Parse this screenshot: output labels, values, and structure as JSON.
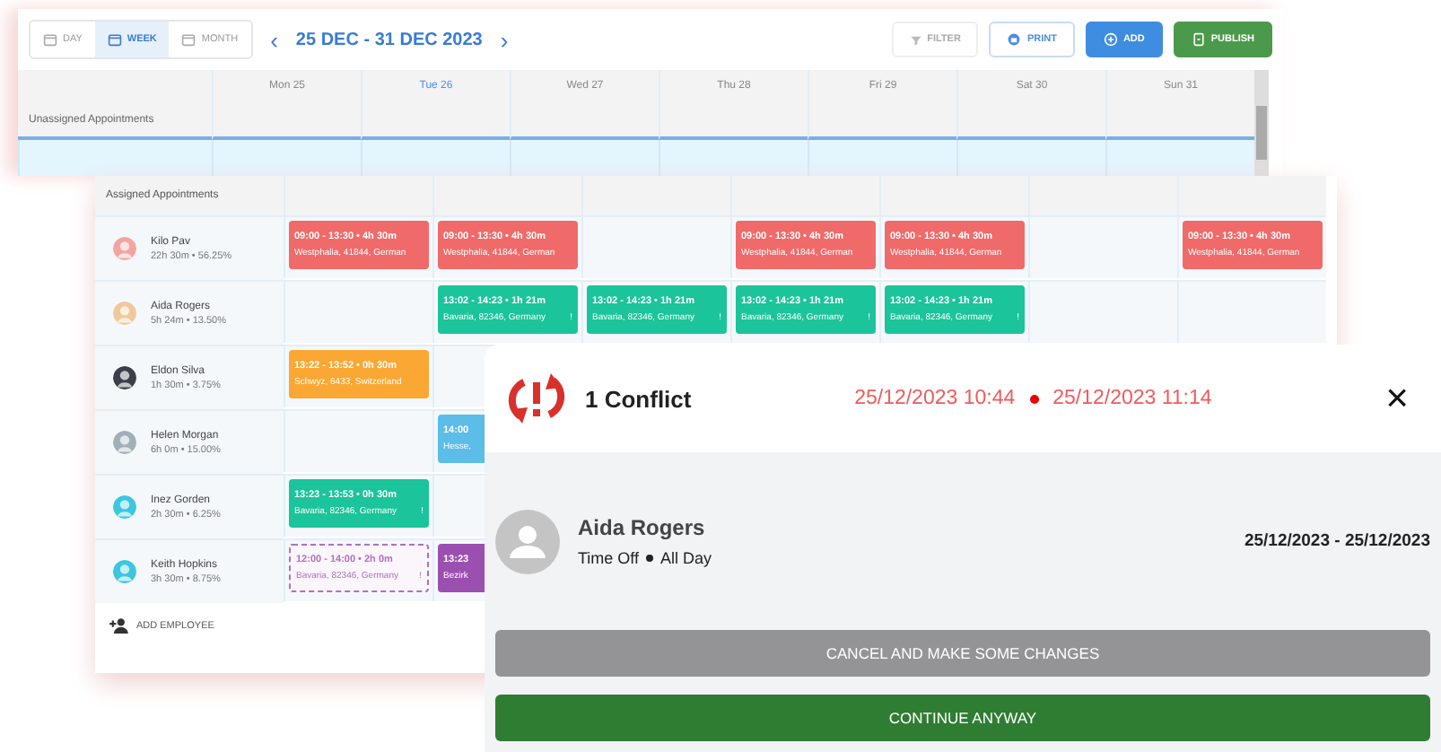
{
  "toolbar": {
    "views": [
      {
        "label": "DAY",
        "selected": false
      },
      {
        "label": "WEEK",
        "selected": true
      },
      {
        "label": "MONTH",
        "selected": false
      }
    ],
    "prev": "‹",
    "range": "25 DEC - 31 DEC 2023",
    "next": "›",
    "actions": [
      {
        "label": "FILTER",
        "kind": "plain"
      },
      {
        "label": "PRINT",
        "kind": "outline"
      },
      {
        "label": "ADD",
        "kind": "primary"
      },
      {
        "label": "PUBLISH",
        "kind": "success"
      }
    ]
  },
  "days": [
    {
      "label": "Mon 25",
      "today": false
    },
    {
      "label": "Tue 26",
      "today": true
    },
    {
      "label": "Wed 27",
      "today": false
    },
    {
      "label": "Thu 28",
      "today": false
    },
    {
      "label": "Fri 29",
      "today": false
    },
    {
      "label": "Sat 30",
      "today": false
    },
    {
      "label": "Sun 31",
      "today": false
    }
  ],
  "unassigned": {
    "label": "Unassigned Appointments"
  },
  "assigned": {
    "label": "Assigned Appointments"
  },
  "employees": [
    {
      "name": "Kilo Pav",
      "stats": "22h 30m • 56.25%",
      "color": "#f4a4a0",
      "cells": [
        {
          "kind": "solid",
          "color": "#f06a6a",
          "time": "09:00 - 13:30 • 4h 30m",
          "place": "Westphalia, 41844, German"
        },
        {
          "kind": "solid",
          "color": "#f06a6a",
          "time": "09:00 - 13:30 • 4h 30m",
          "place": "Westphalia, 41844, German"
        },
        {
          "kind": "empty"
        },
        {
          "kind": "solid",
          "color": "#f06a6a",
          "time": "09:00 - 13:30 • 4h 30m",
          "place": "Westphalia, 41844, German"
        },
        {
          "kind": "solid",
          "color": "#f06a6a",
          "time": "09:00 - 13:30 • 4h 30m",
          "place": "Westphalia, 41844, German"
        },
        {
          "kind": "empty"
        },
        {
          "kind": "solid",
          "color": "#f06a6a",
          "time": "09:00 - 13:30 • 4h 30m",
          "place": "Westphalia, 41844, German"
        }
      ]
    },
    {
      "name": "Aida Rogers",
      "stats": "5h 24m • 13.50%",
      "color": "#f0c89a",
      "cells": [
        {
          "kind": "empty"
        },
        {
          "kind": "solid",
          "color": "#1bc49a",
          "time": "13:02 - 14:23 • 1h 21m",
          "place": "Bavaria, 82346, Germany",
          "flag": "!"
        },
        {
          "kind": "solid",
          "color": "#1bc49a",
          "time": "13:02 - 14:23 • 1h 21m",
          "place": "Bavaria, 82346, Germany",
          "flag": "!"
        },
        {
          "kind": "solid",
          "color": "#1bc49a",
          "time": "13:02 - 14:23 • 1h 21m",
          "place": "Bavaria, 82346, Germany",
          "flag": "!"
        },
        {
          "kind": "solid",
          "color": "#1bc49a",
          "time": "13:02 - 14:23 • 1h 21m",
          "place": "Bavaria, 82346, Germany",
          "flag": "!"
        },
        {
          "kind": "empty"
        },
        {
          "kind": "empty"
        }
      ]
    },
    {
      "name": "Eldon Silva",
      "stats": "1h 30m • 3.75%",
      "color": "#3a3f4a",
      "cells": [
        {
          "kind": "solid",
          "color": "#fba733",
          "time": "13:22 - 13:52 • 0h 30m",
          "place": "Schwyz, 6433, Switzerland"
        },
        {
          "kind": "empty"
        },
        {
          "kind": "empty"
        },
        {
          "kind": "empty"
        },
        {
          "kind": "empty"
        },
        {
          "kind": "empty"
        },
        {
          "kind": "empty"
        }
      ]
    },
    {
      "name": "Helen Morgan",
      "stats": "6h 0m • 15.00%",
      "color": "#9fb0b8",
      "cells": [
        {
          "kind": "empty"
        },
        {
          "kind": "solid",
          "color": "#5bbde8",
          "time": "14:00",
          "place": "Hesse,"
        },
        {
          "kind": "empty"
        },
        {
          "kind": "empty"
        },
        {
          "kind": "empty"
        },
        {
          "kind": "empty"
        },
        {
          "kind": "empty"
        }
      ]
    },
    {
      "name": "Inez Gorden",
      "stats": "2h 30m • 6.25%",
      "color": "#3cc6e0",
      "cells": [
        {
          "kind": "solid",
          "color": "#1bc49a",
          "time": "13:23 - 13:53 • 0h 30m",
          "place": "Bavaria, 82346, Germany",
          "flag": "!"
        },
        {
          "kind": "empty"
        },
        {
          "kind": "empty"
        },
        {
          "kind": "empty"
        },
        {
          "kind": "empty"
        },
        {
          "kind": "empty"
        },
        {
          "kind": "empty"
        }
      ]
    },
    {
      "name": "Keith Hopkins",
      "stats": "3h 30m • 8.75%",
      "color": "#3cc6e0",
      "cells": [
        {
          "kind": "dashed",
          "color": "#b070c0",
          "time": "12:00 - 14:00 • 2h 0m",
          "place": "Bavaria, 82346, Germany",
          "flag": "!"
        },
        {
          "kind": "solid",
          "color": "#9b4fb0",
          "time": "13:23",
          "place": "Bezirk"
        },
        {
          "kind": "empty"
        },
        {
          "kind": "empty"
        },
        {
          "kind": "empty"
        },
        {
          "kind": "empty"
        },
        {
          "kind": "empty"
        }
      ]
    }
  ],
  "add_employee": "ADD EMPLOYEE",
  "conflict": {
    "title": "1 Conflict",
    "start": "25/12/2023 10:44",
    "end": "25/12/2023 11:14",
    "close": "×",
    "person": {
      "name": "Aida Rogers",
      "type": "Time Off",
      "duration": "All Day",
      "range": "25/12/2023 - 25/12/2023"
    },
    "buttons": [
      {
        "label": "CANCEL AND MAKE SOME CHANGES",
        "kind": "cancel"
      },
      {
        "label": "CONTINUE ANYWAY",
        "kind": "confirm"
      }
    ]
  }
}
